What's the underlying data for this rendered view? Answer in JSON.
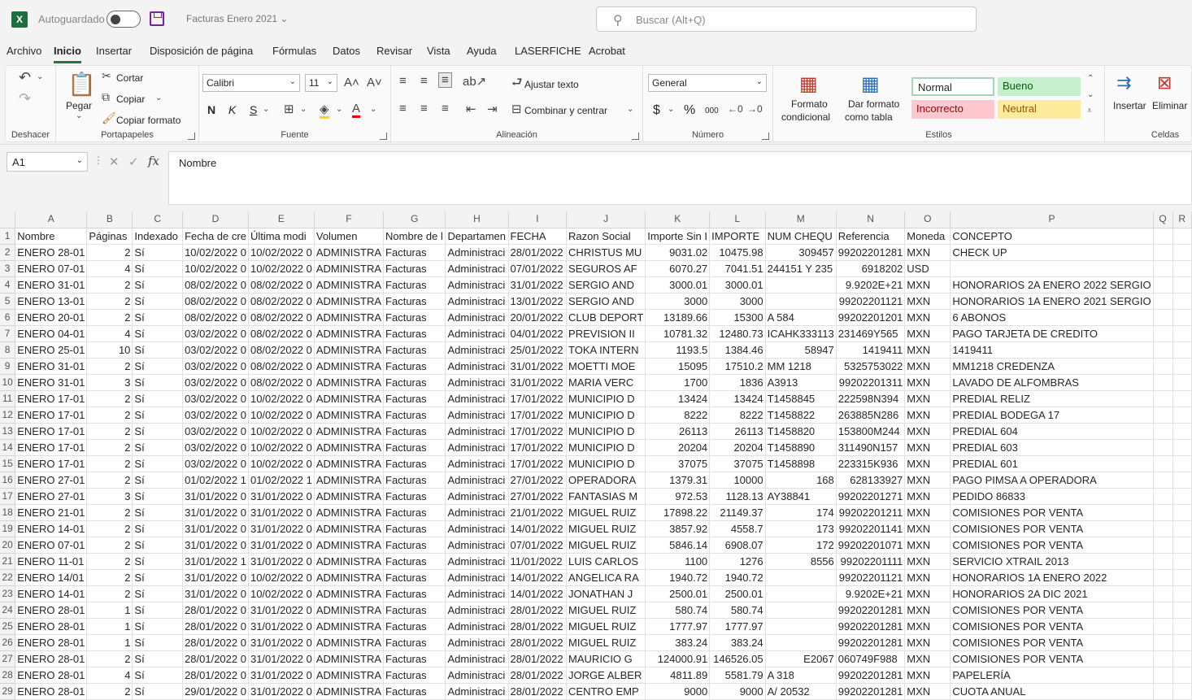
{
  "titlebar": {
    "app_icon": "X",
    "autosave_label": "Autoguardado",
    "doc_title": "Facturas Enero 2021",
    "search_placeholder": "Buscar (Alt+Q)"
  },
  "tabs": [
    "Archivo",
    "Inicio",
    "Insertar",
    "Disposición de página",
    "Fórmulas",
    "Datos",
    "Revisar",
    "Vista",
    "Ayuda",
    "LASERFICHE",
    "Acrobat"
  ],
  "ribbon": {
    "undo_group": "Deshacer",
    "clipboard": {
      "paste": "Pegar",
      "cut": "Cortar",
      "copy": "Copiar",
      "format_painter": "Copiar formato",
      "group": "Portapapeles"
    },
    "font": {
      "name": "Calibri",
      "size": "11",
      "bold": "N",
      "italic": "K",
      "underline": "S",
      "group": "Fuente"
    },
    "alignment": {
      "wrap": "Ajustar texto",
      "merge": "Combinar y centrar",
      "group": "Alineación"
    },
    "number": {
      "format": "General",
      "currency": "$",
      "percent": "%",
      "thousands": "000",
      "group": "Número"
    },
    "styles": {
      "cond_format": "Formato",
      "cond_format2": "condicional",
      "table_format": "Dar formato",
      "table_format2": "como tabla",
      "normal": "Normal",
      "good": "Bueno",
      "bad": "Incorrecto",
      "neutral": "Neutral",
      "group": "Estilos"
    },
    "cells": {
      "insert": "Insertar",
      "delete": "Eliminar",
      "group": "Celdas"
    }
  },
  "formula": {
    "cell_ref": "A1",
    "fx": "fx",
    "content": "Nombre"
  },
  "colors": {
    "accent": "#217346",
    "good_bg": "#c6efce",
    "good_fg": "#006100",
    "bad_bg": "#ffc7ce",
    "bad_fg": "#9c0006",
    "neutral_bg": "#ffeb9c",
    "neutral_fg": "#9c5700"
  },
  "sheet": {
    "columns": [
      "A",
      "B",
      "C",
      "D",
      "E",
      "F",
      "G",
      "H",
      "I",
      "J",
      "K",
      "L",
      "M",
      "N",
      "O",
      "P",
      "Q",
      "R"
    ],
    "rows": [
      [
        "Nombre",
        "Páginas",
        "Indexado",
        "Fecha de cre",
        "Última modi",
        "Volumen",
        "Nombre de l",
        "Departamen",
        "FECHA",
        "Razon Social",
        "Importe Sin I",
        "IMPORTE",
        "NUM CHEQU",
        "Referencia",
        "Moneda",
        "CONCEPTO",
        "",
        ""
      ],
      [
        "ENERO 28-01",
        "2",
        "Sí",
        "10/02/2022 0",
        "10/02/2022 0",
        "ADMINISTRA",
        "Facturas",
        "Administraci",
        "28/01/2022",
        "CHRISTUS MU",
        "9031.02",
        "10475.98",
        "309457",
        "99202201281",
        "MXN",
        "CHECK UP",
        "",
        ""
      ],
      [
        "ENERO 07-01",
        "4",
        "Sí",
        "10/02/2022 0",
        "10/02/2022 0",
        "ADMINISTRA",
        "Facturas",
        "Administraci",
        "07/01/2022",
        "SEGUROS AF",
        "6070.27",
        "7041.51",
        "244151 Y 235",
        "6918202",
        "USD",
        "",
        "",
        ""
      ],
      [
        "ENERO 31-01",
        "2",
        "Sí",
        "08/02/2022 0",
        "08/02/2022 0",
        "ADMINISTRA",
        "Facturas",
        "Administraci",
        "31/01/2022",
        "SERGIO AND",
        "3000.01",
        "3000.01",
        "",
        "9.9202E+21",
        "MXN",
        "HONORARIOS 2A ENERO 2022 SERGIO",
        "",
        ""
      ],
      [
        "ENERO 13-01",
        "2",
        "Sí",
        "08/02/2022 0",
        "08/02/2022 0",
        "ADMINISTRA",
        "Facturas",
        "Administraci",
        "13/01/2022",
        "SERGIO AND",
        "3000",
        "3000",
        "",
        "99202201121",
        "MXN",
        "HONORARIOS 1A ENERO 2021 SERGIO",
        "",
        ""
      ],
      [
        "ENERO 20-01",
        "2",
        "Sí",
        "08/02/2022 0",
        "08/02/2022 0",
        "ADMINISTRA",
        "Facturas",
        "Administraci",
        "20/01/2022",
        "CLUB DEPORT",
        "13189.66",
        "15300",
        "A 584",
        "99202201201",
        "MXN",
        "6 ABONOS",
        "",
        ""
      ],
      [
        "ENERO 04-01",
        "4",
        "Sí",
        "03/02/2022 0",
        "08/02/2022 0",
        "ADMINISTRA",
        "Facturas",
        "Administraci",
        "04/01/2022",
        "PREVISION II",
        "10781.32",
        "12480.73",
        "ICAHK333113",
        "231469Y565",
        "MXN",
        "PAGO TARJETA DE CREDITO",
        "",
        ""
      ],
      [
        "ENERO 25-01",
        "10",
        "Sí",
        "03/02/2022 0",
        "08/02/2022 0",
        "ADMINISTRA",
        "Facturas",
        "Administraci",
        "25/01/2022",
        "TOKA INTERN",
        "1193.5",
        "1384.46",
        "58947",
        "1419411",
        "MXN",
        "1419411",
        "",
        ""
      ],
      [
        "ENERO 31-01",
        "2",
        "Sí",
        "03/02/2022 0",
        "08/02/2022 0",
        "ADMINISTRA",
        "Facturas",
        "Administraci",
        "31/01/2022",
        "MOETTI MOE",
        "15095",
        "17510.2",
        "MM 1218",
        "5325753022",
        "MXN",
        "MM1218 CREDENZA",
        "",
        ""
      ],
      [
        "ENERO 31-01",
        "3",
        "Sí",
        "03/02/2022 0",
        "08/02/2022 0",
        "ADMINISTRA",
        "Facturas",
        "Administraci",
        "31/01/2022",
        "MARIA VERC",
        "1700",
        "1836",
        "A3913",
        "99202201311",
        "MXN",
        "LAVADO DE ALFOMBRAS",
        "",
        ""
      ],
      [
        "ENERO 17-01",
        "2",
        "Sí",
        "03/02/2022 0",
        "10/02/2022 0",
        "ADMINISTRA",
        "Facturas",
        "Administraci",
        "17/01/2022",
        "MUNICIPIO D",
        "13424",
        "13424",
        "T1458845",
        "222598N394",
        "MXN",
        "PREDIAL RELIZ",
        "",
        ""
      ],
      [
        "ENERO 17-01",
        "2",
        "Sí",
        "03/02/2022 0",
        "10/02/2022 0",
        "ADMINISTRA",
        "Facturas",
        "Administraci",
        "17/01/2022",
        "MUNICIPIO D",
        "8222",
        "8222",
        "T1458822",
        "263885N286",
        "MXN",
        "PREDIAL BODEGA 17",
        "",
        ""
      ],
      [
        "ENERO 17-01",
        "2",
        "Sí",
        "03/02/2022 0",
        "10/02/2022 0",
        "ADMINISTRA",
        "Facturas",
        "Administraci",
        "17/01/2022",
        "MUNICIPIO D",
        "26113",
        "26113",
        "T1458820",
        "153800M244",
        "MXN",
        "PREDIAL 604",
        "",
        ""
      ],
      [
        "ENERO 17-01",
        "2",
        "Sí",
        "03/02/2022 0",
        "10/02/2022 0",
        "ADMINISTRA",
        "Facturas",
        "Administraci",
        "17/01/2022",
        "MUNICIPIO D",
        "20204",
        "20204",
        "T1458890",
        "311490N157",
        "MXN",
        "PREDIAL 603",
        "",
        ""
      ],
      [
        "ENERO 17-01",
        "2",
        "Sí",
        "03/02/2022 0",
        "10/02/2022 0",
        "ADMINISTRA",
        "Facturas",
        "Administraci",
        "17/01/2022",
        "MUNICIPIO D",
        "37075",
        "37075",
        "T1458898",
        "223315K936",
        "MXN",
        "PREDIAL 601",
        "",
        ""
      ],
      [
        "ENERO 27-01",
        "2",
        "Sí",
        "01/02/2022 1",
        "01/02/2022 1",
        "ADMINISTRA",
        "Facturas",
        "Administraci",
        "27/01/2022",
        "OPERADORA",
        "1379.31",
        "10000",
        "168",
        "628133927",
        "MXN",
        "PAGO PIMSA A OPERADORA",
        "",
        ""
      ],
      [
        "ENERO 27-01",
        "3",
        "Sí",
        "31/01/2022 0",
        "31/01/2022 0",
        "ADMINISTRA",
        "Facturas",
        "Administraci",
        "27/01/2022",
        "FANTASIAS M",
        "972.53",
        "1128.13",
        "AY38841",
        "99202201271",
        "MXN",
        "PEDIDO 86833",
        "",
        ""
      ],
      [
        "ENERO 21-01",
        "2",
        "Sí",
        "31/01/2022 0",
        "31/01/2022 0",
        "ADMINISTRA",
        "Facturas",
        "Administraci",
        "21/01/2022",
        "MIGUEL RUIZ",
        "17898.22",
        "21149.37",
        "174",
        "99202201211",
        "MXN",
        "COMISIONES POR VENTA",
        "",
        ""
      ],
      [
        "ENERO 14-01",
        "2",
        "Sí",
        "31/01/2022 0",
        "31/01/2022 0",
        "ADMINISTRA",
        "Facturas",
        "Administraci",
        "14/01/2022",
        "MIGUEL RUIZ",
        "3857.92",
        "4558.7",
        "173",
        "99202201141",
        "MXN",
        "COMISIONES POR VENTA",
        "",
        ""
      ],
      [
        "ENERO 07-01",
        "2",
        "Sí",
        "31/01/2022 0",
        "31/01/2022 0",
        "ADMINISTRA",
        "Facturas",
        "Administraci",
        "07/01/2022",
        "MIGUEL RUIZ",
        "5846.14",
        "6908.07",
        "172",
        "99202201071",
        "MXN",
        "COMISIONES POR VENTA",
        "",
        ""
      ],
      [
        "ENERO 11-01",
        "2",
        "Sí",
        "31/01/2022 1",
        "31/01/2022 0",
        "ADMINISTRA",
        "Facturas",
        "Administraci",
        "11/01/2022",
        "LUIS CARLOS",
        "1100",
        "1276",
        "8556",
        "99202201111",
        "MXN",
        "SERVICIO XTRAIL 2013",
        "",
        ""
      ],
      [
        "ENERO 14/01",
        "2",
        "Sí",
        "31/01/2022 0",
        "10/02/2022 0",
        "ADMINISTRA",
        "Facturas",
        "Administraci",
        "14/01/2022",
        "ANGELICA RA",
        "1940.72",
        "1940.72",
        "",
        "99202201121",
        "MXN",
        "HONORARIOS 1A ENERO 2022",
        "",
        ""
      ],
      [
        "ENERO 14-01",
        "2",
        "Sí",
        "31/01/2022 0",
        "10/02/2022 0",
        "ADMINISTRA",
        "Facturas",
        "Administraci",
        "14/01/2022",
        "JONATHAN J",
        "2500.01",
        "2500.01",
        "",
        "9.9202E+21",
        "MXN",
        "HONORARIOS 2A DIC 2021",
        "",
        ""
      ],
      [
        "ENERO 28-01",
        "1",
        "Sí",
        "28/01/2022 0",
        "31/01/2022 0",
        "ADMINISTRA",
        "Facturas",
        "Administraci",
        "28/01/2022",
        "MIGUEL RUIZ",
        "580.74",
        "580.74",
        "",
        "99202201281",
        "MXN",
        "COMISIONES POR VENTA",
        "",
        ""
      ],
      [
        "ENERO 28-01",
        "1",
        "Sí",
        "28/01/2022 0",
        "31/01/2022 0",
        "ADMINISTRA",
        "Facturas",
        "Administraci",
        "28/01/2022",
        "MIGUEL RUIZ",
        "1777.97",
        "1777.97",
        "",
        "99202201281",
        "MXN",
        "COMISIONES POR VENTA",
        "",
        ""
      ],
      [
        "ENERO 28-01",
        "1",
        "Sí",
        "28/01/2022 0",
        "31/01/2022 0",
        "ADMINISTRA",
        "Facturas",
        "Administraci",
        "28/01/2022",
        "MIGUEL RUIZ",
        "383.24",
        "383.24",
        "",
        "99202201281",
        "MXN",
        "COMISIONES POR VENTA",
        "",
        ""
      ],
      [
        "ENERO 28-01",
        "2",
        "Sí",
        "28/01/2022 0",
        "31/01/2022 0",
        "ADMINISTRA",
        "Facturas",
        "Administraci",
        "28/01/2022",
        "MAURICIO G",
        "124000.91",
        "146526.05",
        "E2067",
        "060749F988",
        "MXN",
        "COMISIONES POR VENTA",
        "",
        ""
      ],
      [
        "ENERO 28-01",
        "4",
        "Sí",
        "28/01/2022 0",
        "31/01/2022 0",
        "ADMINISTRA",
        "Facturas",
        "Administraci",
        "28/01/2022",
        "JORGE ALBER",
        "4811.89",
        "5581.79",
        "A 318",
        "99202201281",
        "MXN",
        "PAPELERÍA",
        "",
        ""
      ],
      [
        "ENERO 28-01",
        "2",
        "Sí",
        "29/01/2022 0",
        "31/01/2022 0",
        "ADMINISTRA",
        "Facturas",
        "Administraci",
        "28/01/2022",
        "CENTRO EMP",
        "9000",
        "9000",
        "A/ 20532",
        "99202201281",
        "MXN",
        "CUOTA ANUAL",
        "",
        ""
      ]
    ]
  }
}
